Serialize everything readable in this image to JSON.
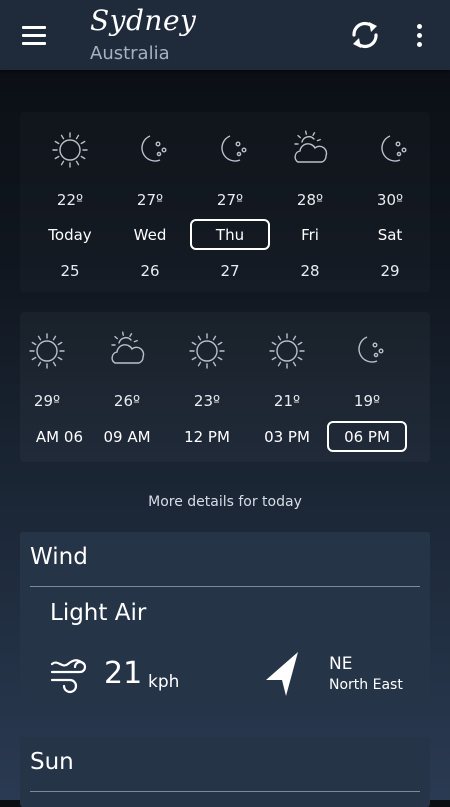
{
  "header": {
    "city": "Sydney",
    "country": "Australia",
    "menu_icon": "hamburger-menu-icon",
    "refresh_icon": "refresh-icon",
    "more_icon": "more-vertical-icon"
  },
  "daily": [
    {
      "icon": "sun",
      "temp": "22º",
      "label": "Today",
      "date": "25",
      "selected": false
    },
    {
      "icon": "moon-stars",
      "temp": "27º",
      "label": "Wed",
      "date": "26",
      "selected": false
    },
    {
      "icon": "moon-stars",
      "temp": "27º",
      "label": "Thu",
      "date": "27",
      "selected": true
    },
    {
      "icon": "cloud-sun",
      "temp": "28º",
      "label": "Fri",
      "date": "28",
      "selected": false
    },
    {
      "icon": "moon-stars",
      "temp": "30º",
      "label": "Sat",
      "date": "29",
      "selected": false
    }
  ],
  "hourly": [
    {
      "icon": "sun",
      "temp": "29º",
      "time": "06 AM",
      "selected": false
    },
    {
      "icon": "cloud-sun",
      "temp": "26º",
      "time": "09 AM",
      "selected": false
    },
    {
      "icon": "sun",
      "temp": "23º",
      "time": "12 PM",
      "selected": false
    },
    {
      "icon": "sun",
      "temp": "21º",
      "time": "03 PM",
      "selected": false
    },
    {
      "icon": "moon-stars",
      "temp": "19º",
      "time": "06 PM",
      "selected": true
    }
  ],
  "more_details": "More details for today",
  "wind": {
    "title": "Wind",
    "description": "Light Air",
    "speed": "21",
    "unit": "kph",
    "direction_code": "NE",
    "direction_name": "North East"
  },
  "sun": {
    "title": "Sun"
  }
}
